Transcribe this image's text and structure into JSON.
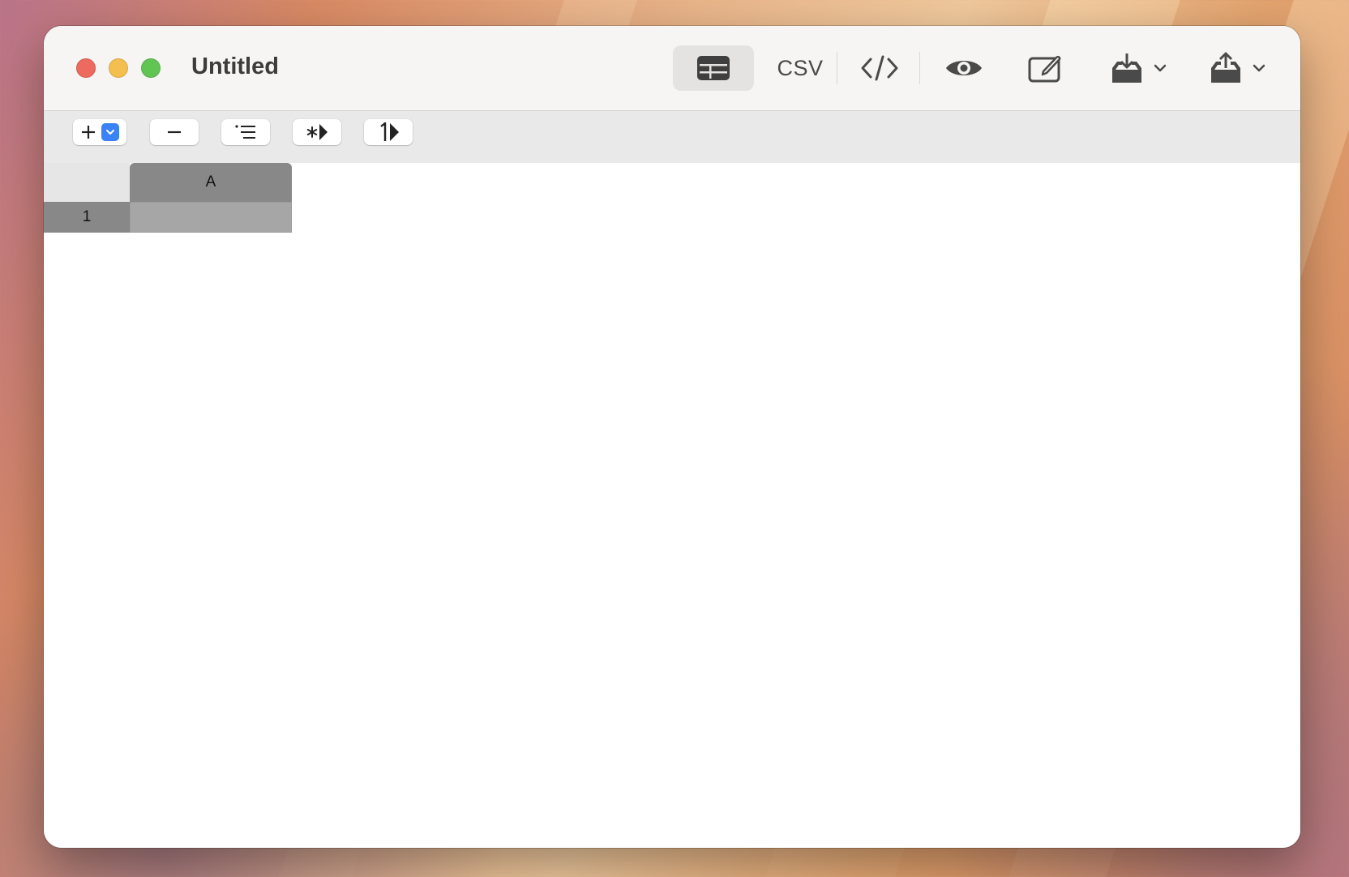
{
  "window": {
    "title": "Untitled"
  },
  "toolbar": {
    "table_view_icon": "table-icon",
    "csv_label": "CSV",
    "code_view_icon": "code-icon",
    "preview_icon": "eye-icon",
    "edit_icon": "compose-icon",
    "import_icon": "tray-download-icon",
    "export_icon": "tray-upload-icon"
  },
  "edit_toolbar": {
    "add_icon": "plus-icon",
    "remove_icon": "minus-icon",
    "list_icon": "list-icon",
    "wildcard_icon": "asterisk-triangle-icon",
    "number_icon": "one-triangle-icon"
  },
  "grid": {
    "columns": [
      "A"
    ],
    "rows": [
      {
        "number": "1",
        "cells": [
          ""
        ]
      }
    ]
  },
  "colors": {
    "close": "#ed6a5e",
    "minimize": "#f5bf4f",
    "zoom": "#61c554",
    "accent": "#3b82f6",
    "selected_header": "#888888",
    "selected_cell": "#a6a6a6"
  }
}
